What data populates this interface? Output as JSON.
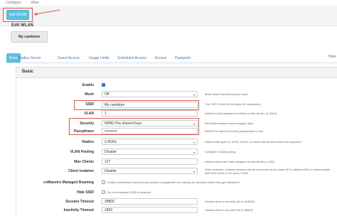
{
  "breadcrumb": {
    "items": [
      "Configure",
      "Wlan"
    ]
  },
  "toolbar": {
    "add_label": "Add WLAN"
  },
  "edit": {
    "title": "Edit WLAN",
    "wlan_name": "My cambium"
  },
  "tabs": [
    "Basic",
    "Radius Server",
    "Guest Access",
    "Usage Limits",
    "Scheduled Access",
    "Access",
    "Passpoint",
    "Dele"
  ],
  "section_title": "Basic",
  "form": {
    "enable": {
      "label": "Enable",
      "checked": true
    },
    "mesh": {
      "label": "Mesh",
      "value": "Off",
      "hint": "Mesh Base/Client/Recovery mode"
    },
    "ssid": {
      "label": "SSID",
      "value": "My cambium",
      "hint": "The SSID of this WLAN (upto 32 characters)"
    },
    "vlan": {
      "label": "VLAN",
      "value": "1",
      "hint": "Default VLAN assigned to clients on this WLAN. (1-4094)"
    },
    "security": {
      "label": "Security",
      "value": "WPA2 Pre-shared Keys",
      "hint": "Set Authentication and encryption type"
    },
    "passphrase": {
      "label": "Passphrase",
      "value": "••••••••••",
      "hint": "WPA2 Pre-shared Security passphrase or Key"
    },
    "radios": {
      "label": "Radios",
      "value": "2.4GHz",
      "hint": "Select radio types (2.4GHz, 5GHz) on which this WLAN should be supported"
    },
    "vlan_pooling": {
      "label": "VLAN Pooling",
      "value": "Disable",
      "hint": "Configure VLAN pooling"
    },
    "max_clients": {
      "label": "Max Clients",
      "value": "127",
      "hint": "Default maximum Client assigned to this WLAN (1-256)"
    },
    "client_isolation": {
      "label": "Client Isolation",
      "value": "Disable",
      "hint": "When selected, it allows wireless clients connected to the same AP or different APs to communicate with each other in the same VLAN"
    },
    "onmaestro": {
      "label": "cnMaestro Managed Roaming",
      "text": "Enable centralized Guest Access session management of roaming for wireless clients through cnMaestro",
      "checked": false
    },
    "hide_ssid": {
      "label": "Hide SSID",
      "text": "Do not broadcast SSID in beacons",
      "checked": false
    },
    "session_timeout": {
      "label": "Session Timeout",
      "value": "28800",
      "hint": "Session time in seconds (60 to 604800)"
    },
    "inactivity_timeout": {
      "label": "Inactivity Timeout",
      "value": "1800",
      "hint": "Session time in seconds (60 to 28800)"
    }
  },
  "colors": {
    "accent": "#5bc0de",
    "highlight": "#e4554d",
    "checkbox": "#2a7ae2"
  }
}
